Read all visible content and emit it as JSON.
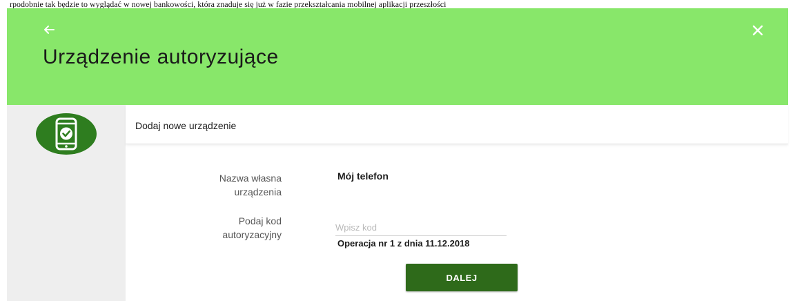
{
  "caption": "rpodobnie tak będzie to wyglądać w nowej bankowości, która znaduje się już w fazie przekształcania mobilnej aplikacji przeszłości",
  "header": {
    "title": "Urządzenie autoryzujące",
    "back_icon": "arrow-left-icon",
    "close_icon": "close-icon",
    "background": "#88e76a"
  },
  "sidebar": {
    "icon": "phone-check-icon",
    "badge_color": "#2e7d1f"
  },
  "section": {
    "title": "Dodaj nowe urządzenie"
  },
  "form": {
    "device_name": {
      "label_line1": "Nazwa własna",
      "label_line2": "urządzenia",
      "value": "Mój telefon"
    },
    "auth_code": {
      "label_line1": "Podaj kod",
      "label_line2": "autoryzacyjny",
      "value": "",
      "placeholder": "Wpisz kod"
    },
    "operation_info": "Operacja nr 1 z dnia 11.12.2018"
  },
  "actions": {
    "next_label": "DALEJ",
    "next_color": "#2e6a1a"
  }
}
